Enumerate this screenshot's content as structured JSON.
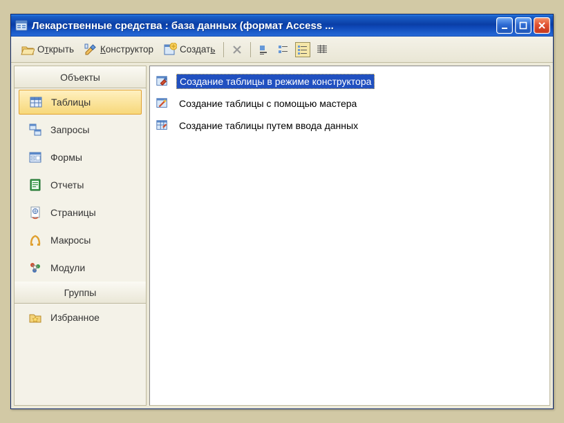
{
  "window": {
    "title": "Лекарственные средства : база данных (формат Access ..."
  },
  "toolbar": {
    "open": "Открыть",
    "design": "Конструктор",
    "design_u": "К",
    "create": "Создать",
    "create_u": "ь"
  },
  "sidebar": {
    "header_objects": "Объекты",
    "header_groups": "Группы",
    "items": [
      {
        "label": "Таблицы"
      },
      {
        "label": "Запросы"
      },
      {
        "label": "Формы"
      },
      {
        "label": "Отчеты"
      },
      {
        "label": "Страницы"
      },
      {
        "label": "Макросы"
      },
      {
        "label": "Модули"
      }
    ],
    "favorites": "Избранное"
  },
  "main": {
    "items": [
      {
        "label": "Создание таблицы в режиме конструктора"
      },
      {
        "label": "Создание таблицы с помощью мастера"
      },
      {
        "label": "Создание таблицы путем ввода данных"
      }
    ]
  }
}
